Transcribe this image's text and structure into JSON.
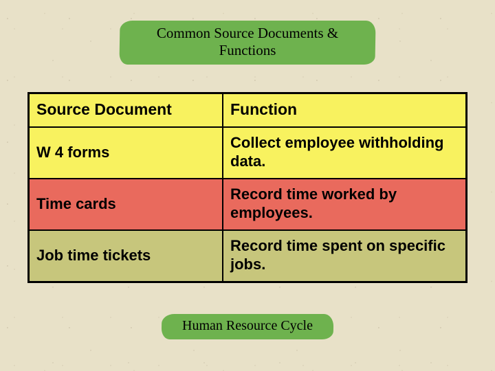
{
  "title": "Common Source Documents & Functions",
  "footer": "Human Resource Cycle",
  "table": {
    "headers": {
      "col1": "Source Document",
      "col2": "Function"
    },
    "rows": [
      {
        "doc": "W 4 forms",
        "func": "Collect employee withholding data."
      },
      {
        "doc": "Time cards",
        "func": "Record time worked by employees."
      },
      {
        "doc": "Job time tickets",
        "func": "Record time spent on specific jobs."
      }
    ]
  }
}
